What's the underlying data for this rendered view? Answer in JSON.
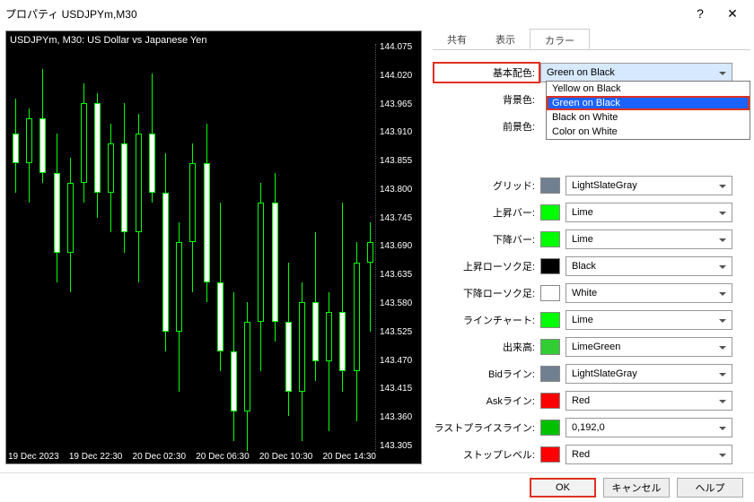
{
  "window": {
    "title": "プロパティ USDJPYm,M30"
  },
  "chart": {
    "title": "USDJPYm, M30:  US Dollar vs Japanese Yen",
    "y_ticks": [
      "144.075",
      "144.020",
      "143.965",
      "143.910",
      "143.855",
      "143.800",
      "143.745",
      "143.690",
      "143.635",
      "143.580",
      "143.525",
      "143.470",
      "143.415",
      "143.360",
      "143.305"
    ],
    "x_ticks": [
      "19 Dec 2023",
      "19 Dec 22:30",
      "20 Dec 02:30",
      "20 Dec 06:30",
      "20 Dec 10:30",
      "20 Dec 14:30"
    ]
  },
  "tabs": {
    "t0": "共有",
    "t1": "表示",
    "t2": "カラー"
  },
  "scheme": {
    "label": "基本配色:",
    "value": "Green on Black",
    "options": [
      "Yellow on Black",
      "Green on Black",
      "Black on White",
      "Color on White"
    ]
  },
  "rows": {
    "bg": {
      "label": "背景色:"
    },
    "fg": {
      "label": "前景色:"
    },
    "grid": {
      "label": "グリッド:",
      "value": "LightSlateGray",
      "color": "#708090"
    },
    "bar_up": {
      "label": "上昇バー:",
      "value": "Lime",
      "color": "#00ff00"
    },
    "bar_dn": {
      "label": "下降バー:",
      "value": "Lime",
      "color": "#00ff00"
    },
    "cand_up": {
      "label": "上昇ローソク足:",
      "value": "Black",
      "color": "#000000"
    },
    "cand_dn": {
      "label": "下降ローソク足:",
      "value": "White",
      "color": "#ffffff"
    },
    "linechart": {
      "label": "ラインチャート:",
      "value": "Lime",
      "color": "#00ff00"
    },
    "volume": {
      "label": "出来高:",
      "value": "LimeGreen",
      "color": "#32cd32"
    },
    "bid": {
      "label": "Bidライン:",
      "value": "LightSlateGray",
      "color": "#708090"
    },
    "ask": {
      "label": "Askライン:",
      "value": "Red",
      "color": "#ff0000"
    },
    "last": {
      "label": "ラストプライスライン:",
      "value": "0,192,0",
      "color": "#00c000"
    },
    "stop": {
      "label": "ストップレベル:",
      "value": "Red",
      "color": "#ff0000"
    }
  },
  "footer": {
    "ok": "OK",
    "cancel": "キャンセル",
    "help": "ヘルプ"
  },
  "chart_data": {
    "type": "candlestick",
    "title": "USDJPYm, M30",
    "ylim": [
      143.28,
      144.1
    ],
    "candles": [
      {
        "i": 0,
        "o": 143.92,
        "h": 143.99,
        "l": 143.8,
        "c": 143.86
      },
      {
        "i": 1,
        "o": 143.86,
        "h": 143.97,
        "l": 143.78,
        "c": 143.95
      },
      {
        "i": 2,
        "o": 143.95,
        "h": 144.05,
        "l": 143.82,
        "c": 143.84
      },
      {
        "i": 3,
        "o": 143.84,
        "h": 143.92,
        "l": 143.62,
        "c": 143.68
      },
      {
        "i": 4,
        "o": 143.68,
        "h": 143.87,
        "l": 143.6,
        "c": 143.82
      },
      {
        "i": 5,
        "o": 143.82,
        "h": 144.02,
        "l": 143.78,
        "c": 143.98
      },
      {
        "i": 6,
        "o": 143.98,
        "h": 144.0,
        "l": 143.75,
        "c": 143.8
      },
      {
        "i": 7,
        "o": 143.8,
        "h": 143.94,
        "l": 143.72,
        "c": 143.9
      },
      {
        "i": 8,
        "o": 143.9,
        "h": 143.98,
        "l": 143.68,
        "c": 143.72
      },
      {
        "i": 9,
        "o": 143.72,
        "h": 143.96,
        "l": 143.62,
        "c": 143.92
      },
      {
        "i": 10,
        "o": 143.92,
        "h": 144.04,
        "l": 143.78,
        "c": 143.8
      },
      {
        "i": 11,
        "o": 143.8,
        "h": 143.88,
        "l": 143.48,
        "c": 143.52
      },
      {
        "i": 12,
        "o": 143.52,
        "h": 143.74,
        "l": 143.4,
        "c": 143.7
      },
      {
        "i": 13,
        "o": 143.7,
        "h": 143.9,
        "l": 143.6,
        "c": 143.86
      },
      {
        "i": 14,
        "o": 143.86,
        "h": 143.94,
        "l": 143.58,
        "c": 143.62
      },
      {
        "i": 15,
        "o": 143.62,
        "h": 143.78,
        "l": 143.44,
        "c": 143.48
      },
      {
        "i": 16,
        "o": 143.48,
        "h": 143.6,
        "l": 143.3,
        "c": 143.36
      },
      {
        "i": 17,
        "o": 143.36,
        "h": 143.58,
        "l": 143.28,
        "c": 143.54
      },
      {
        "i": 18,
        "o": 143.54,
        "h": 143.82,
        "l": 143.44,
        "c": 143.78
      },
      {
        "i": 19,
        "o": 143.78,
        "h": 143.84,
        "l": 143.5,
        "c": 143.54
      },
      {
        "i": 20,
        "o": 143.54,
        "h": 143.66,
        "l": 143.35,
        "c": 143.4
      },
      {
        "i": 21,
        "o": 143.4,
        "h": 143.62,
        "l": 143.3,
        "c": 143.58
      },
      {
        "i": 22,
        "o": 143.58,
        "h": 143.72,
        "l": 143.42,
        "c": 143.46
      },
      {
        "i": 23,
        "o": 143.46,
        "h": 143.6,
        "l": 143.32,
        "c": 143.56
      },
      {
        "i": 24,
        "o": 143.56,
        "h": 143.78,
        "l": 143.4,
        "c": 143.44
      },
      {
        "i": 25,
        "o": 143.44,
        "h": 143.7,
        "l": 143.34,
        "c": 143.66
      },
      {
        "i": 26,
        "o": 143.66,
        "h": 143.74,
        "l": 143.52,
        "c": 143.7
      }
    ]
  }
}
